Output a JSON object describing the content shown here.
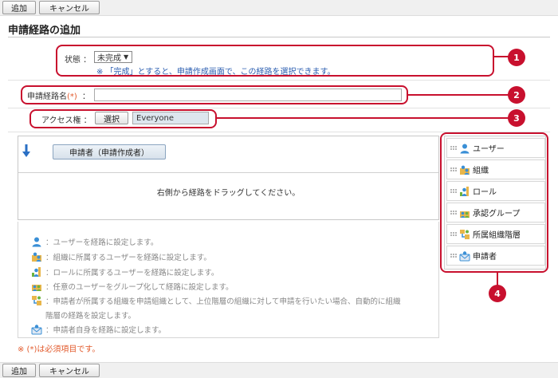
{
  "toolbar": {
    "add_label": "追加",
    "cancel_label": "キャンセル"
  },
  "page_title": "申請経路の追加",
  "status": {
    "label": "状態 ：",
    "selected": "未完成",
    "note": "※ 「完成」とすると、申請作成画面で、この経路を選択できます。"
  },
  "route_name": {
    "label": "申請経路名",
    "required_mark": "(*)",
    "colon": "：",
    "value": ""
  },
  "access": {
    "label": "アクセス権 ：",
    "select_button": "選択",
    "value": "Everyone"
  },
  "route": {
    "applicant_chip": "申請者（申請作成者）",
    "drop_hint": "右側から経路をドラッグしてください。"
  },
  "legend": [
    {
      "icon": "user-icon",
      "text": "：ユーザーを経路に設定します。"
    },
    {
      "icon": "organization-icon",
      "text": "：組織に所属するユーザーを経路に設定します。"
    },
    {
      "icon": "role-icon",
      "text": "：ロールに所属するユーザーを経路に設定します。"
    },
    {
      "icon": "approval-group-icon",
      "text": "：任意のユーザーをグループ化して経路に設定します。"
    },
    {
      "icon": "org-hierarchy-icon",
      "text": "：申請者が所属する組織を申請組織として、上位階層の組織に対して申請を行いたい場合、自動的に組織"
    },
    {
      "icon": "",
      "text": "階層の経路を設定します。"
    },
    {
      "icon": "applicant-icon",
      "text": "：申請者自身を経路に設定します。"
    }
  ],
  "palette": [
    {
      "icon": "user-icon",
      "label": "ユーザー"
    },
    {
      "icon": "organization-icon",
      "label": "組織"
    },
    {
      "icon": "role-icon",
      "label": "ロール"
    },
    {
      "icon": "approval-group-icon",
      "label": "承認グループ"
    },
    {
      "icon": "org-hierarchy-icon",
      "label": "所属組織階層"
    },
    {
      "icon": "applicant-icon",
      "label": "申請者"
    }
  ],
  "required_note": "※ (*)は必須項目です。",
  "callouts": [
    "1",
    "2",
    "3",
    "4"
  ],
  "colors": {
    "callout": "#c8102e",
    "required": "#e25a2c",
    "note": "#2a5db0"
  }
}
